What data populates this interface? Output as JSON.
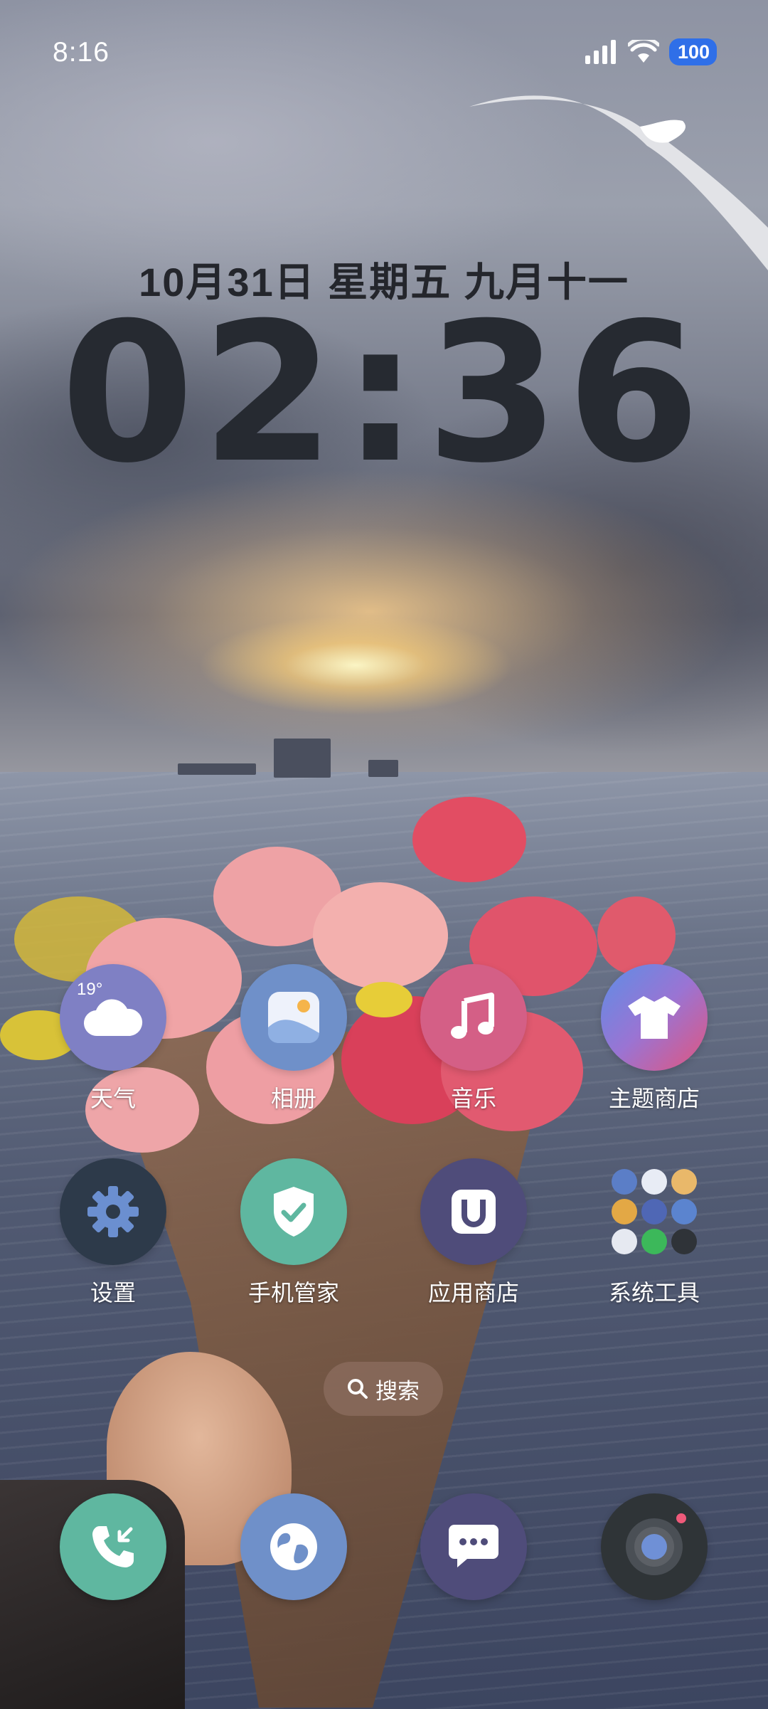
{
  "status_bar": {
    "time": "8:16",
    "battery": "100",
    "icons": [
      "signal-icon",
      "wifi-icon",
      "battery-icon"
    ]
  },
  "clock_widget": {
    "date": "10月31日 星期五 九月十一",
    "time": "02:36"
  },
  "apps": [
    {
      "label": "天气",
      "icon": "weather-cloud-icon",
      "temp": "19°",
      "color": "#7f80c4"
    },
    {
      "label": "相册",
      "icon": "gallery-icon",
      "color": "#6f90c9"
    },
    {
      "label": "音乐",
      "icon": "music-note-icon",
      "color": "#d45f86"
    },
    {
      "label": "主题商店",
      "icon": "theme-shirt-icon",
      "color": "#8a78d8"
    },
    {
      "label": "设置",
      "icon": "gear-icon",
      "color": "#2d3a4a"
    },
    {
      "label": "手机管家",
      "icon": "shield-check-icon",
      "color": "#5fb7a0"
    },
    {
      "label": "应用商店",
      "icon": "app-store-icon",
      "color": "#4f4c7a"
    },
    {
      "label": "系统工具",
      "icon": "folder-icon"
    }
  ],
  "search": {
    "label": "搜索",
    "icon": "search-icon"
  },
  "dock": [
    {
      "icon": "phone-icon",
      "color": "#5fb7a0"
    },
    {
      "icon": "browser-globe-icon",
      "color": "#6f90c9"
    },
    {
      "icon": "messages-icon",
      "color": "#4f4c7a"
    },
    {
      "icon": "camera-icon",
      "color": "#2f3437"
    }
  ]
}
